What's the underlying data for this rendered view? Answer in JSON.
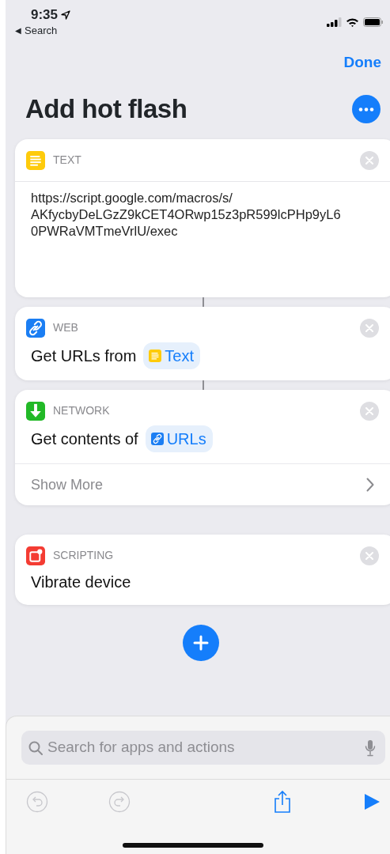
{
  "status_bar": {
    "time": "9:35",
    "back_arrow": "◀",
    "back_label": "Search"
  },
  "nav": {
    "done": "Done"
  },
  "title": "Add hot flash",
  "actions": [
    {
      "category": "TEXT",
      "color": "#fecb0b",
      "kind": "text",
      "body": {
        "kind": "text",
        "lines": [
          "https://script.google.com/macros/s/",
          "AKfycbyDeLGzZ9kCET4ORwp15z3pR599lcPHp9yL6",
          "0PWRaVMTmeVrlU/exec"
        ]
      }
    },
    {
      "category": "WEB",
      "color": "#1b7ef3",
      "kind": "web",
      "body": {
        "kind": "param",
        "prefix": "Get URLs from",
        "token": {
          "label": "Text",
          "kind": "text",
          "color": "#fecb0b"
        }
      }
    },
    {
      "category": "NETWORK",
      "color": "#22b927",
      "kind": "network",
      "body": {
        "kind": "param",
        "prefix": "Get contents of",
        "token": {
          "label": "URLs",
          "kind": "web",
          "color": "#1b7ef3"
        }
      },
      "show_more": "Show More"
    },
    {
      "category": "SCRIPTING",
      "color": "#f43c33",
      "kind": "scripting",
      "body": {
        "kind": "plain",
        "label": "Vibrate device"
      }
    }
  ],
  "search": {
    "placeholder": "Search for apps and actions"
  },
  "toolbar": {
    "undo_disabled": true,
    "redo_disabled": true
  }
}
